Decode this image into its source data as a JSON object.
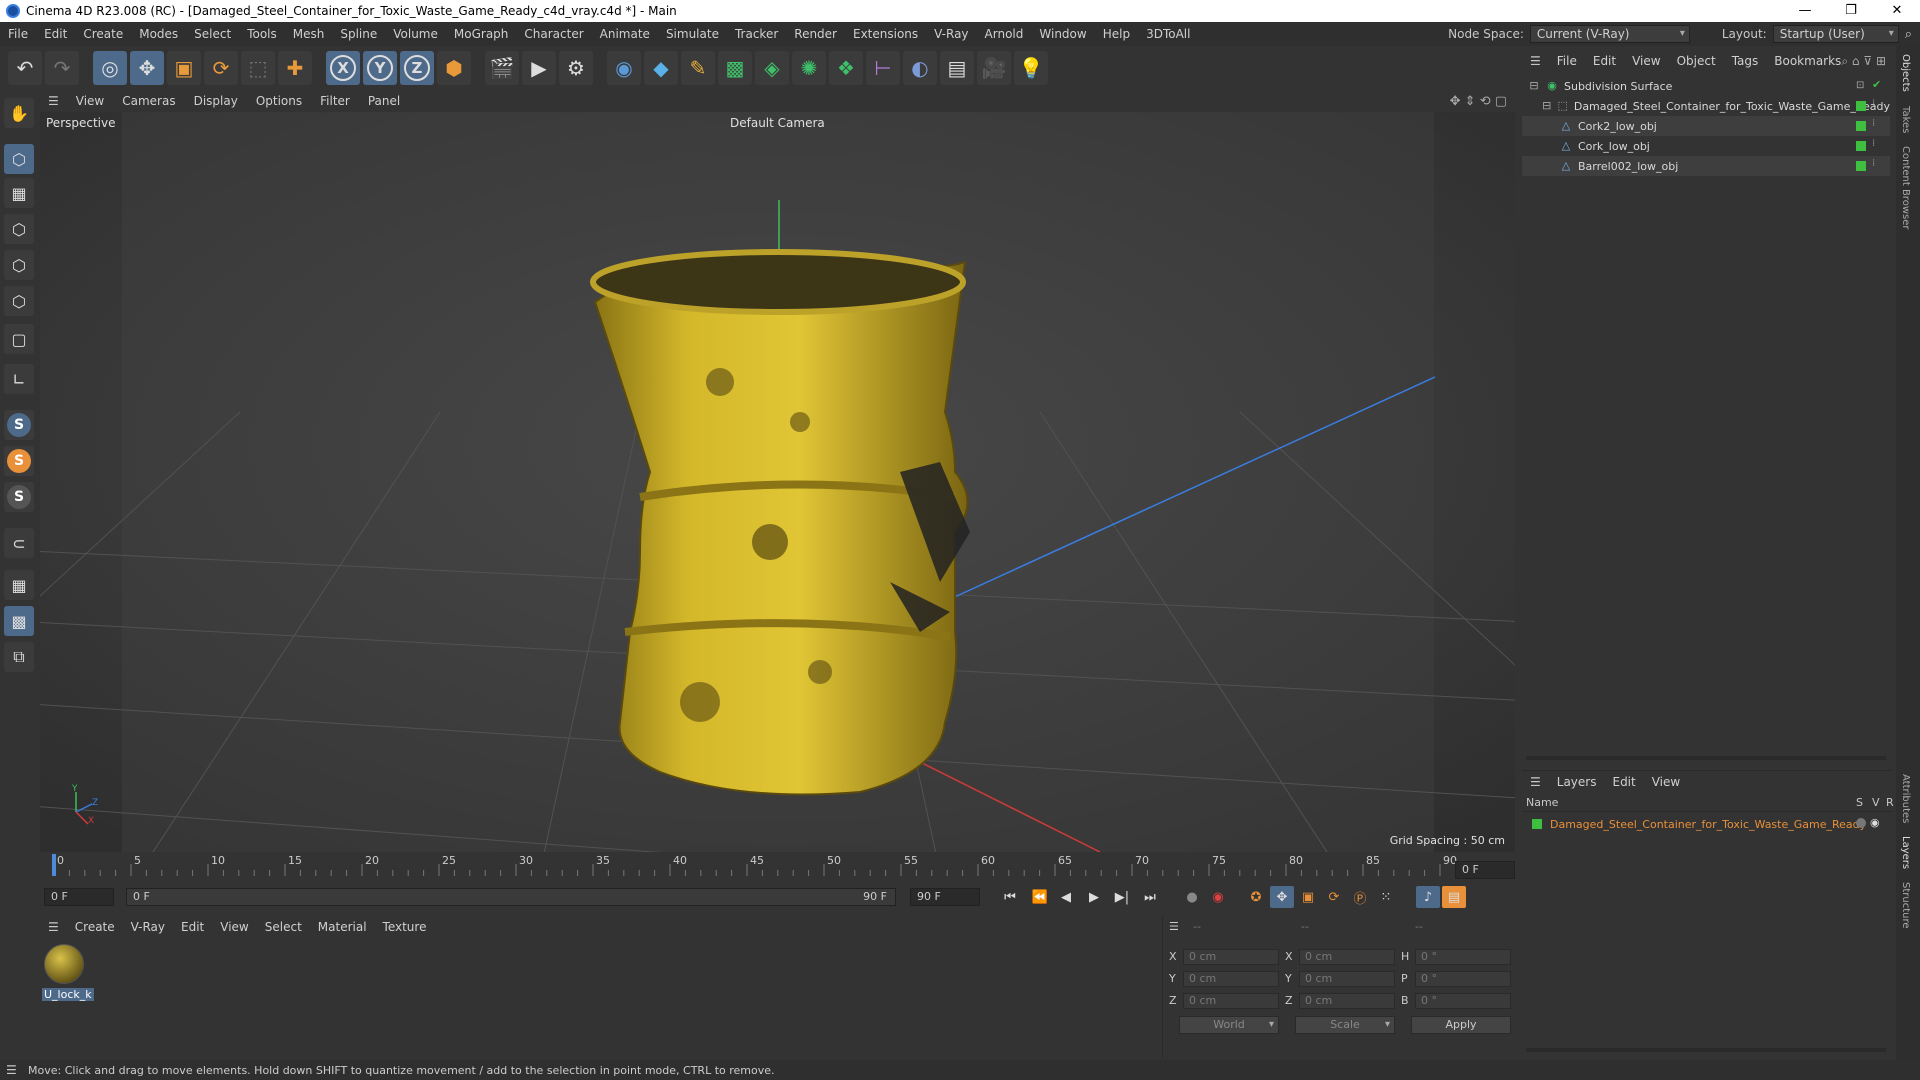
{
  "window": {
    "title": "Cinema 4D R23.008 (RC) - [Damaged_Steel_Container_for_Toxic_Waste_Game_Ready_c4d_vray.c4d *] - Main",
    "minimize": "—",
    "restore": "❐",
    "close": "✕"
  },
  "menubar": {
    "items": [
      "File",
      "Edit",
      "Create",
      "Modes",
      "Select",
      "Tools",
      "Mesh",
      "Spline",
      "Volume",
      "MoGraph",
      "Character",
      "Animate",
      "Simulate",
      "Tracker",
      "Render",
      "Extensions",
      "V-Ray",
      "Arnold",
      "Window",
      "Help",
      "3DToAll"
    ],
    "node_space_label": "Node Space:",
    "node_space_value": "Current (V-Ray)",
    "layout_label": "Layout:",
    "layout_value": "Startup (User)"
  },
  "toolbar": {
    "x_axis": "X",
    "y_axis": "Y",
    "z_axis": "Z"
  },
  "leftbar": {
    "snap1": "S",
    "snap2": "S",
    "snap3": "S"
  },
  "viewport": {
    "menu": [
      "View",
      "Cameras",
      "Display",
      "Options",
      "Filter",
      "Panel"
    ],
    "projection": "Perspective",
    "camera": "Default Camera",
    "grid_spacing": "Grid Spacing : 50 cm",
    "axis_x": "X",
    "axis_y": "Y",
    "axis_z": "Z"
  },
  "timeline": {
    "ticks": [
      "0",
      "5",
      "10",
      "15",
      "20",
      "25",
      "30",
      "35",
      "40",
      "45",
      "50",
      "55",
      "60",
      "65",
      "70",
      "75",
      "80",
      "85",
      "90"
    ],
    "current_frame_right": "0 F",
    "start_field": "0 F",
    "range_start": "0 F",
    "range_end": "90 F",
    "end_field": "90 F"
  },
  "material_manager": {
    "menu": [
      "Create",
      "V-Ray",
      "Edit",
      "View",
      "Select",
      "Material",
      "Texture"
    ],
    "material_name": "U_lock_k"
  },
  "coordinates": {
    "header_left": "--",
    "header_mid": "--",
    "header_right": "--",
    "x_label": "X",
    "y_label": "Y",
    "z_label": "Z",
    "x2_label": "X",
    "y2_label": "Y",
    "z2_label": "Z",
    "h_label": "H",
    "p_label": "P",
    "b_label": "B",
    "pos_x": "0 cm",
    "pos_y": "0 cm",
    "pos_z": "0 cm",
    "size_x": "0 cm",
    "size_y": "0 cm",
    "size_z": "0 cm",
    "rot_h": "0 °",
    "rot_p": "0 °",
    "rot_b": "0 °",
    "world": "World",
    "scale": "Scale",
    "apply": "Apply"
  },
  "object_manager": {
    "menu": [
      "File",
      "Edit",
      "View",
      "Object",
      "Tags",
      "Bookmarks"
    ],
    "objects": [
      {
        "name": "Subdivision Surface"
      },
      {
        "name": "Damaged_Steel_Container_for_Toxic_Waste_Game_Ready"
      },
      {
        "name": "Cork2_low_obj"
      },
      {
        "name": "Cork_low_obj"
      },
      {
        "name": "Barrel002_low_obj"
      }
    ]
  },
  "layers_manager": {
    "menu": [
      "Layers",
      "Edit",
      "View"
    ],
    "col_name": "Name",
    "col_s": "S",
    "col_v": "V",
    "col_r": "R",
    "layer_name": "Damaged_Steel_Container_for_Toxic_Waste_Game_Ready"
  },
  "side_tabs": [
    "Objects",
    "Takes",
    "Content Browser",
    "Attributes",
    "Layers",
    "Structure"
  ],
  "status": "Move: Click and drag to move elements. Hold down SHIFT to quantize movement / add to the selection in point mode, CTRL to remove.",
  "colors": {
    "accent_blue": "#4d6a8a",
    "layer_orange": "#e8903a",
    "barrel_yellow": "#d4b82a"
  }
}
